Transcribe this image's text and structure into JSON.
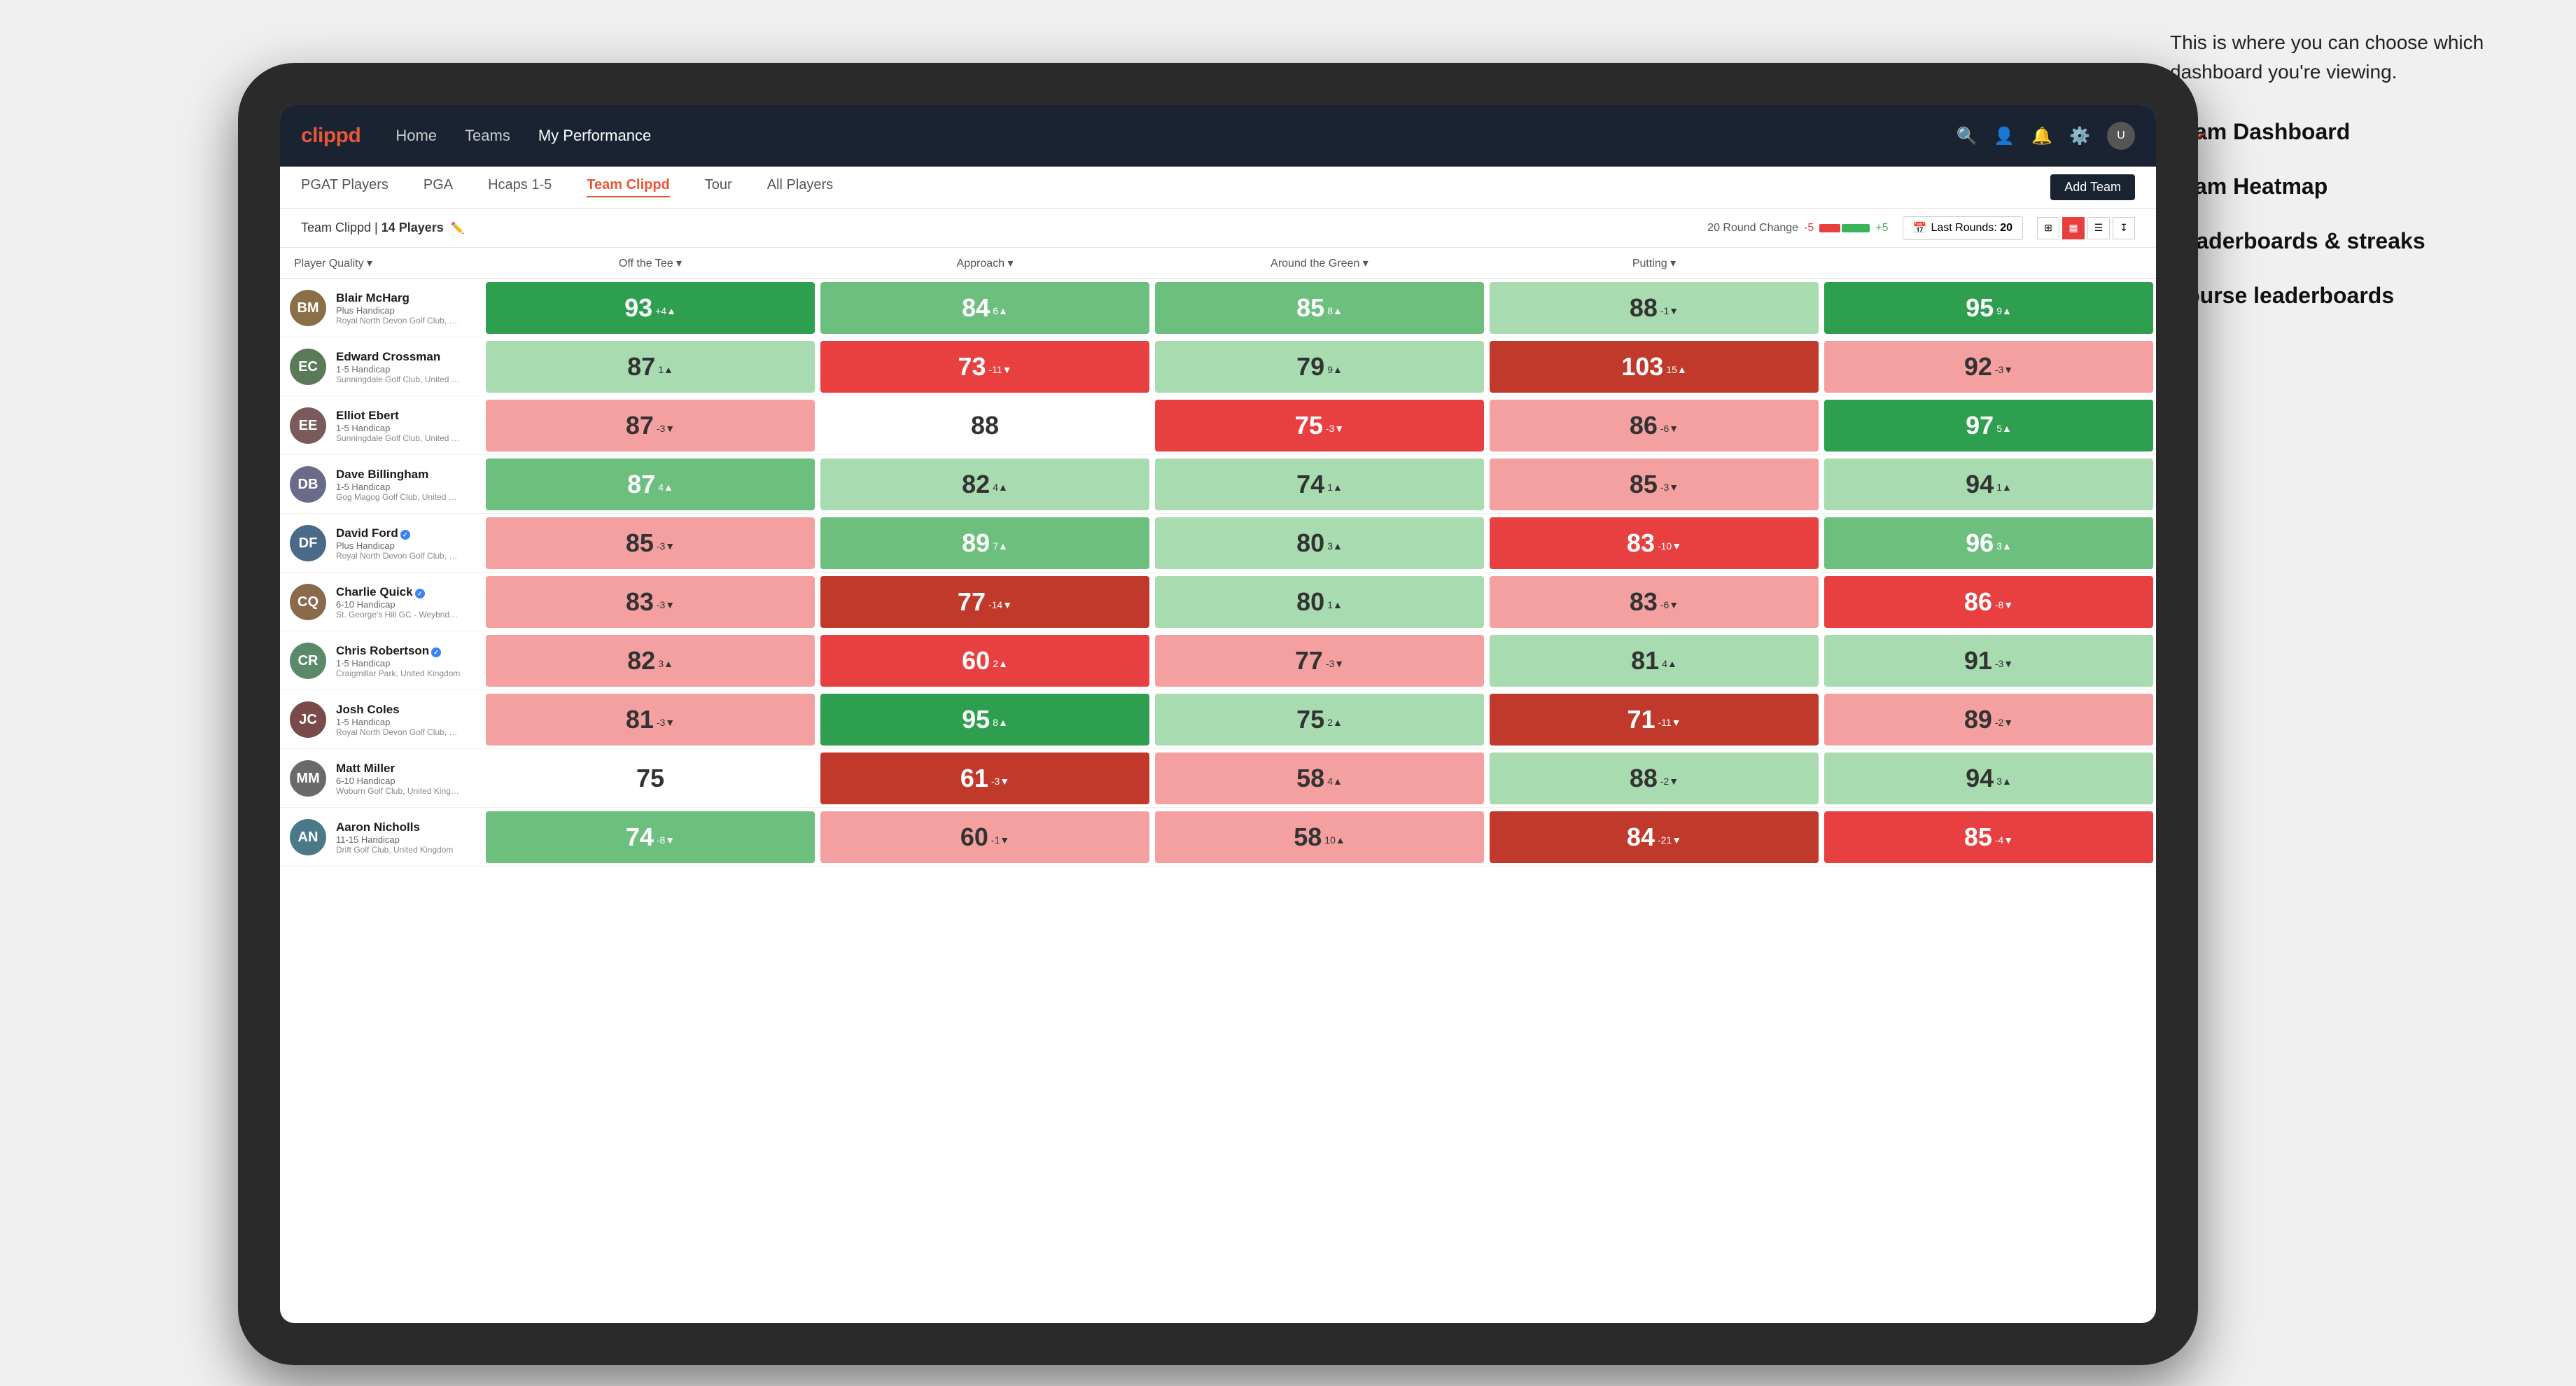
{
  "annotation": {
    "intro": "This is where you can choose which dashboard you're viewing.",
    "items": [
      "Team Dashboard",
      "Team Heatmap",
      "Leaderboards & streaks",
      "Course leaderboards"
    ]
  },
  "navbar": {
    "logo": "clippd",
    "links": [
      "Home",
      "Teams",
      "My Performance"
    ],
    "active_link": "My Performance"
  },
  "sub_tabs": {
    "tabs": [
      "PGAT Players",
      "PGA",
      "Hcaps 1-5",
      "Team Clippd",
      "Tour",
      "All Players"
    ],
    "active_tab": "Team Clippd",
    "add_team_label": "Add Team"
  },
  "team_header": {
    "name": "Team Clippd",
    "separator": "|",
    "count": "14 Players",
    "round_change_label": "20 Round Change",
    "change_minus": "-5",
    "change_plus": "+5",
    "last_rounds_label": "Last Rounds:",
    "last_rounds_value": "20"
  },
  "col_headers": {
    "player": "Player Quality ▾",
    "off_tee": "Off the Tee ▾",
    "approach": "Approach ▾",
    "around_green": "Around the Green ▾",
    "putting": "Putting ▾"
  },
  "players": [
    {
      "name": "Blair McHarg",
      "hcp": "Plus Handicap",
      "club": "Royal North Devon Golf Club, United Kingdom",
      "initials": "BM",
      "color": "#8B6F47",
      "verified": false,
      "scores": {
        "quality": {
          "value": 93,
          "change": "+4",
          "dir": "up",
          "bg": "bg-dark-green"
        },
        "off_tee": {
          "value": 84,
          "change": "6",
          "dir": "up",
          "bg": "bg-mid-green"
        },
        "approach": {
          "value": 85,
          "change": "8",
          "dir": "up",
          "bg": "bg-mid-green"
        },
        "around": {
          "value": 88,
          "change": "-1",
          "dir": "down",
          "bg": "bg-light-green"
        },
        "putting": {
          "value": 95,
          "change": "9",
          "dir": "up",
          "bg": "bg-dark-green"
        }
      }
    },
    {
      "name": "Edward Crossman",
      "hcp": "1-5 Handicap",
      "club": "Sunningdale Golf Club, United Kingdom",
      "initials": "EC",
      "color": "#5a7a5a",
      "verified": false,
      "scores": {
        "quality": {
          "value": 87,
          "change": "1",
          "dir": "up",
          "bg": "bg-light-green"
        },
        "off_tee": {
          "value": 73,
          "change": "-11",
          "dir": "down",
          "bg": "bg-mid-red"
        },
        "approach": {
          "value": 79,
          "change": "9",
          "dir": "up",
          "bg": "bg-light-green"
        },
        "around": {
          "value": 103,
          "change": "15",
          "dir": "up",
          "bg": "bg-dark-red"
        },
        "putting": {
          "value": 92,
          "change": "-3",
          "dir": "down",
          "bg": "bg-light-red"
        }
      }
    },
    {
      "name": "Elliot Ebert",
      "hcp": "1-5 Handicap",
      "club": "Sunningdale Golf Club, United Kingdom",
      "initials": "EE",
      "color": "#7a5a5a",
      "verified": false,
      "scores": {
        "quality": {
          "value": 87,
          "change": "-3",
          "dir": "down",
          "bg": "bg-light-red"
        },
        "off_tee": {
          "value": 88,
          "change": "",
          "dir": "",
          "bg": "bg-white"
        },
        "approach": {
          "value": 75,
          "change": "-3",
          "dir": "down",
          "bg": "bg-mid-red"
        },
        "around": {
          "value": 86,
          "change": "-6",
          "dir": "down",
          "bg": "bg-light-red"
        },
        "putting": {
          "value": 97,
          "change": "5",
          "dir": "up",
          "bg": "bg-dark-green"
        }
      }
    },
    {
      "name": "Dave Billingham",
      "hcp": "1-5 Handicap",
      "club": "Gog Magog Golf Club, United Kingdom",
      "initials": "DB",
      "color": "#6a6a8a",
      "verified": false,
      "scores": {
        "quality": {
          "value": 87,
          "change": "4",
          "dir": "up",
          "bg": "bg-mid-green"
        },
        "off_tee": {
          "value": 82,
          "change": "4",
          "dir": "up",
          "bg": "bg-light-green"
        },
        "approach": {
          "value": 74,
          "change": "1",
          "dir": "up",
          "bg": "bg-light-green"
        },
        "around": {
          "value": 85,
          "change": "-3",
          "dir": "down",
          "bg": "bg-light-red"
        },
        "putting": {
          "value": 94,
          "change": "1",
          "dir": "up",
          "bg": "bg-light-green"
        }
      }
    },
    {
      "name": "David Ford",
      "hcp": "Plus Handicap",
      "club": "Royal North Devon Golf Club, United Kingdom",
      "initials": "DF",
      "color": "#4a6a8a",
      "verified": true,
      "scores": {
        "quality": {
          "value": 85,
          "change": "-3",
          "dir": "down",
          "bg": "bg-light-red"
        },
        "off_tee": {
          "value": 89,
          "change": "7",
          "dir": "up",
          "bg": "bg-mid-green"
        },
        "approach": {
          "value": 80,
          "change": "3",
          "dir": "up",
          "bg": "bg-light-green"
        },
        "around": {
          "value": 83,
          "change": "-10",
          "dir": "down",
          "bg": "bg-mid-red"
        },
        "putting": {
          "value": 96,
          "change": "3",
          "dir": "up",
          "bg": "bg-mid-green"
        }
      }
    },
    {
      "name": "Charlie Quick",
      "hcp": "6-10 Handicap",
      "club": "St. George's Hill GC - Weybridge - Surrey, Uni...",
      "initials": "CQ",
      "color": "#8a6a4a",
      "verified": true,
      "scores": {
        "quality": {
          "value": 83,
          "change": "-3",
          "dir": "down",
          "bg": "bg-light-red"
        },
        "off_tee": {
          "value": 77,
          "change": "-14",
          "dir": "down",
          "bg": "bg-dark-red"
        },
        "approach": {
          "value": 80,
          "change": "1",
          "dir": "up",
          "bg": "bg-light-green"
        },
        "around": {
          "value": 83,
          "change": "-6",
          "dir": "down",
          "bg": "bg-light-red"
        },
        "putting": {
          "value": 86,
          "change": "-8",
          "dir": "down",
          "bg": "bg-mid-red"
        }
      }
    },
    {
      "name": "Chris Robertson",
      "hcp": "1-5 Handicap",
      "club": "Craigmillar Park, United Kingdom",
      "initials": "CR",
      "color": "#5a8a6a",
      "verified": true,
      "scores": {
        "quality": {
          "value": 82,
          "change": "3",
          "dir": "up",
          "bg": "bg-light-red"
        },
        "off_tee": {
          "value": 60,
          "change": "2",
          "dir": "up",
          "bg": "bg-mid-red"
        },
        "approach": {
          "value": 77,
          "change": "-3",
          "dir": "down",
          "bg": "bg-light-red"
        },
        "around": {
          "value": 81,
          "change": "4",
          "dir": "up",
          "bg": "bg-light-green"
        },
        "putting": {
          "value": 91,
          "change": "-3",
          "dir": "down",
          "bg": "bg-light-green"
        }
      }
    },
    {
      "name": "Josh Coles",
      "hcp": "1-5 Handicap",
      "club": "Royal North Devon Golf Club, United Kingdom",
      "initials": "JC",
      "color": "#7a4a4a",
      "verified": false,
      "scores": {
        "quality": {
          "value": 81,
          "change": "-3",
          "dir": "down",
          "bg": "bg-light-red"
        },
        "off_tee": {
          "value": 95,
          "change": "8",
          "dir": "up",
          "bg": "bg-dark-green"
        },
        "approach": {
          "value": 75,
          "change": "2",
          "dir": "up",
          "bg": "bg-light-green"
        },
        "around": {
          "value": 71,
          "change": "-11",
          "dir": "down",
          "bg": "bg-dark-red"
        },
        "putting": {
          "value": 89,
          "change": "-2",
          "dir": "down",
          "bg": "bg-light-red"
        }
      }
    },
    {
      "name": "Matt Miller",
      "hcp": "6-10 Handicap",
      "club": "Woburn Golf Club, United Kingdom",
      "initials": "MM",
      "color": "#6a6a6a",
      "verified": false,
      "scores": {
        "quality": {
          "value": 75,
          "change": "",
          "dir": "",
          "bg": "bg-white"
        },
        "off_tee": {
          "value": 61,
          "change": "-3",
          "dir": "down",
          "bg": "bg-dark-red"
        },
        "approach": {
          "value": 58,
          "change": "4",
          "dir": "up",
          "bg": "bg-light-red"
        },
        "around": {
          "value": 88,
          "change": "-2",
          "dir": "down",
          "bg": "bg-light-green"
        },
        "putting": {
          "value": 94,
          "change": "3",
          "dir": "up",
          "bg": "bg-light-green"
        }
      }
    },
    {
      "name": "Aaron Nicholls",
      "hcp": "11-15 Handicap",
      "club": "Drift Golf Club, United Kingdom",
      "initials": "AN",
      "color": "#4a7a8a",
      "verified": false,
      "scores": {
        "quality": {
          "value": 74,
          "change": "-8",
          "dir": "down",
          "bg": "bg-mid-green"
        },
        "off_tee": {
          "value": 60,
          "change": "-1",
          "dir": "down",
          "bg": "bg-light-red"
        },
        "approach": {
          "value": 58,
          "change": "10",
          "dir": "up",
          "bg": "bg-light-red"
        },
        "around": {
          "value": 84,
          "change": "-21",
          "dir": "down",
          "bg": "bg-dark-red"
        },
        "putting": {
          "value": 85,
          "change": "-4",
          "dir": "down",
          "bg": "bg-mid-red"
        }
      }
    }
  ]
}
